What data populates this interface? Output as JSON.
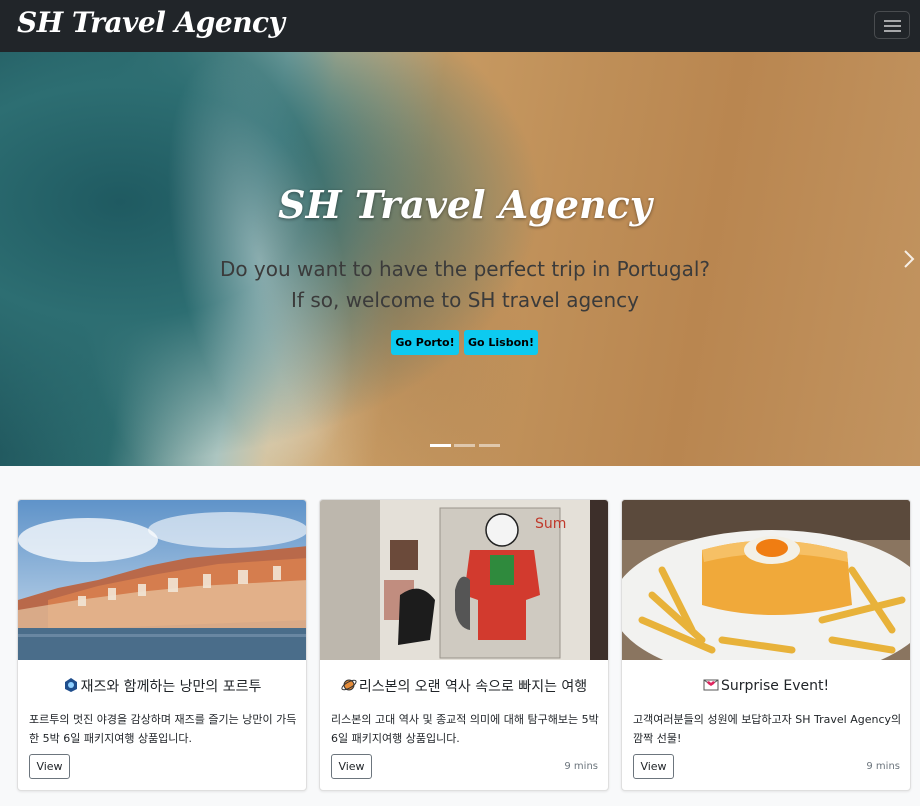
{
  "navbar": {
    "brand": "SH Travel Agency",
    "toggler_icon": "hamburger-menu-icon"
  },
  "hero": {
    "title": "SH Travel Agency",
    "subtitle_line1": "Do you want to have the perfect trip in Portugal?",
    "subtitle_line2": "If so, welcome to SH travel agency",
    "buttons": [
      {
        "label": "Go Porto!"
      },
      {
        "label": "Go Lisbon!"
      }
    ],
    "next_icon": "chevron-right-icon",
    "indicator_count": 3,
    "active_indicator": 1
  },
  "cards": [
    {
      "image": "porto-riverside-photo",
      "icon": "jazz-emoji-icon",
      "title": "재즈와 함께하는 낭만의 포르투",
      "text": "포르투의 멋진 야경을 감상하며 재즈를 즐기는 낭만이 가득한 5박 6일 패키지여행 상품입니다.",
      "button": "View",
      "time": ""
    },
    {
      "image": "lisbon-street-art-photo",
      "icon": "planet-emoji-icon",
      "title": "리스본의 오랜 역사 속으로 빠지는 여행",
      "text": "리스본의 고대 역사 및 종교적 의미에 대해 탐구해보는 5박 6일 패키지여행 상품입니다.",
      "button": "View",
      "time": "9 mins"
    },
    {
      "image": "francesinha-dish-photo",
      "icon": "envelope-heart-emoji-icon",
      "title": "Surprise Event!",
      "text": "고객여러분들의 성원에 보답하고자 SH Travel Agency의 깜짝 선물!",
      "button": "View",
      "time": "9 mins"
    }
  ],
  "colors": {
    "navbar_bg": "#212529",
    "accent_button": "#0dcaf0",
    "page_bg": "#f8f9fa"
  }
}
